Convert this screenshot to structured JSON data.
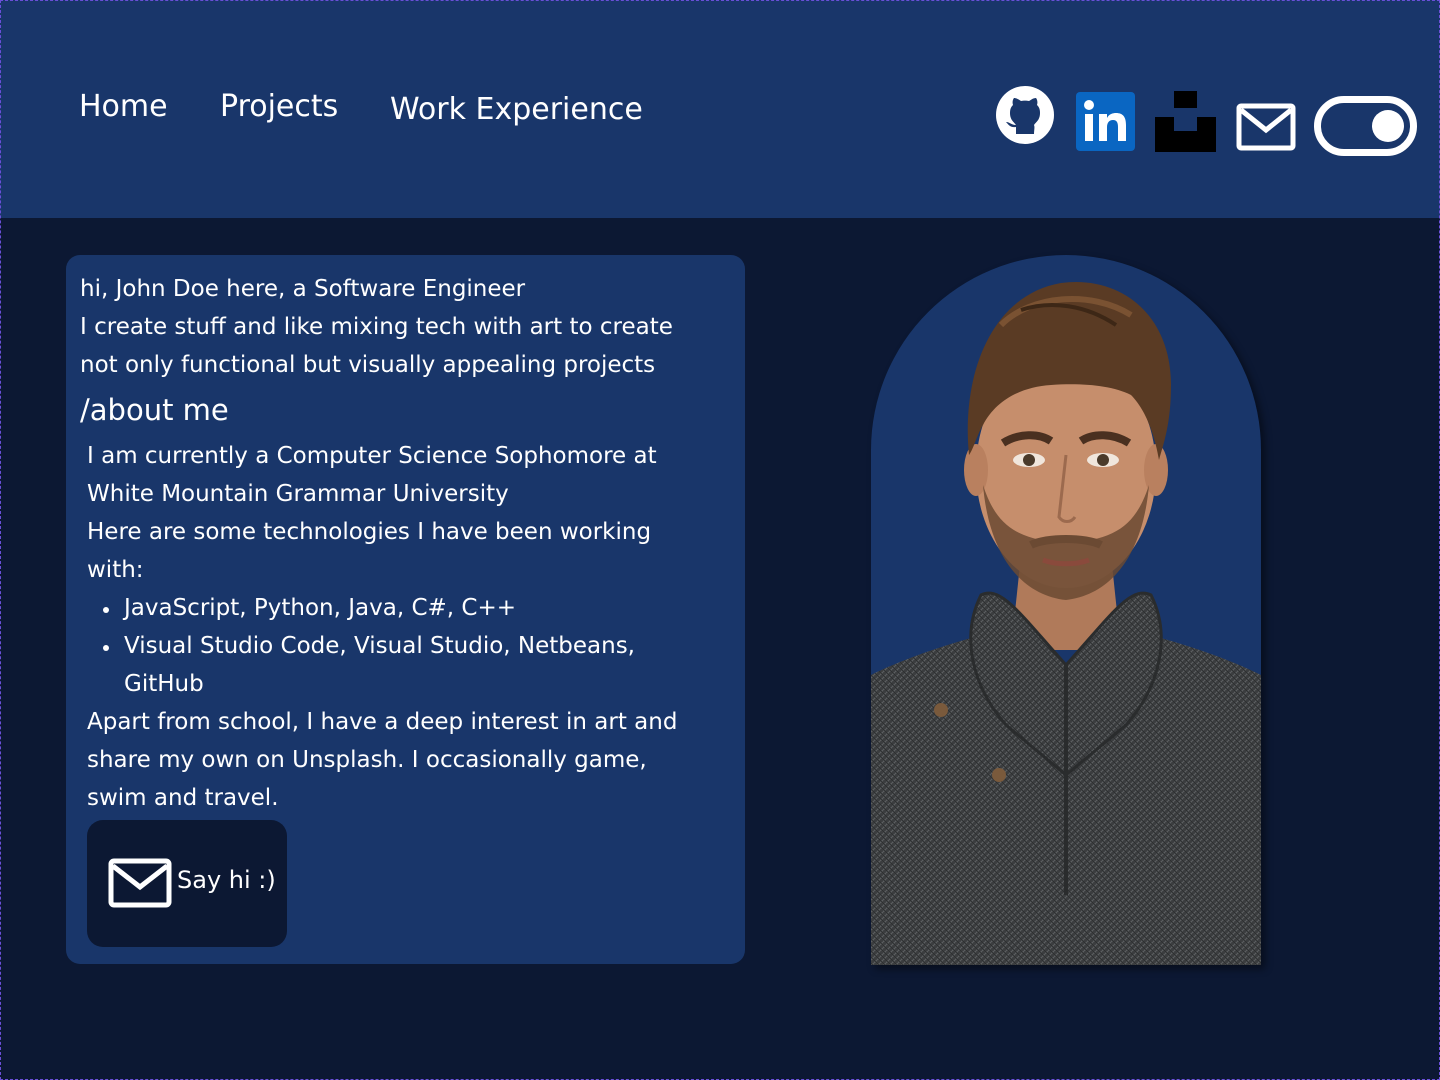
{
  "nav": {
    "home": "Home",
    "projects": "Projects",
    "work_experience": "Work Experience"
  },
  "social": {
    "github": {
      "label": "GitHub",
      "icon": "github-icon"
    },
    "linkedin": {
      "label": "LinkedIn",
      "icon": "linkedin-icon",
      "text": "in",
      "color": "#0a66c2"
    },
    "unsplash": {
      "label": "Unsplash",
      "icon": "unsplash-icon"
    },
    "email": {
      "label": "Email",
      "icon": "mail-icon"
    },
    "theme_toggle": {
      "icon": "toggle-icon",
      "state": "on"
    }
  },
  "intro": {
    "greeting": "hi, John Doe here, a Software Engineer",
    "tagline_1": "I create stuff and like mixing tech with art to create",
    "tagline_2": "not only functional but visually appealing projects"
  },
  "about": {
    "heading": "/about me",
    "p1_line1": "I am currently a Computer Science Sophomore at",
    "p1_line2": "White Mountain Grammar University",
    "p2_line1": "Here are some technologies I have been working",
    "p2_line2": "with:",
    "tech_1": "JavaScript, Python, Java, C#, C++",
    "tech_2_line1": "Visual Studio Code, Visual Studio, Netbeans,",
    "tech_2_line2": "GitHub",
    "p3_line1": "Apart from school, I have a deep interest in art and",
    "p3_line2": "share my own on Unsplash. I occasionally game,",
    "p3_line3": "swim and travel."
  },
  "cta": {
    "label": "Say hi :)",
    "icon": "mail-icon"
  },
  "portrait": {
    "icon": "profile-photo"
  },
  "colors": {
    "page_bg": "#0c1833",
    "header_bg": "#19366a",
    "card_bg": "#19366a",
    "button_bg": "#0c1833",
    "text": "#ffffff"
  }
}
